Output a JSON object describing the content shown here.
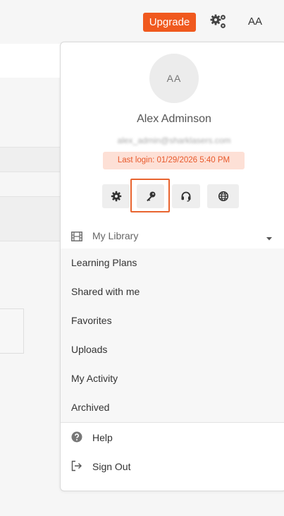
{
  "header": {
    "upgrade_label": "Upgrade",
    "avatar_initials": "AA"
  },
  "profile": {
    "initials": "AA",
    "name": "Alex Adminson",
    "email": "alex_admin@sharklasers.com",
    "last_login": "Last login: 01/29/2026 5:40 PM"
  },
  "quick_actions": [
    {
      "icon": "gear-icon"
    },
    {
      "icon": "key-icon"
    },
    {
      "icon": "headset-icon"
    },
    {
      "icon": "globe-icon"
    }
  ],
  "library": {
    "label": "My Library",
    "icon": "film-icon",
    "expanded": true
  },
  "menu": {
    "items": [
      {
        "label": "Learning Plans"
      },
      {
        "label": "Shared with me"
      },
      {
        "label": "Favorites"
      },
      {
        "label": "Uploads"
      },
      {
        "label": "My Activity"
      },
      {
        "label": "Archived"
      }
    ]
  },
  "footer": {
    "help_label": "Help",
    "signout_label": "Sign Out"
  },
  "colors": {
    "accent": "#f0591e",
    "highlight_border": "#e8642f",
    "last_login_bg": "#fde0d6",
    "last_login_text": "#e8592b"
  }
}
